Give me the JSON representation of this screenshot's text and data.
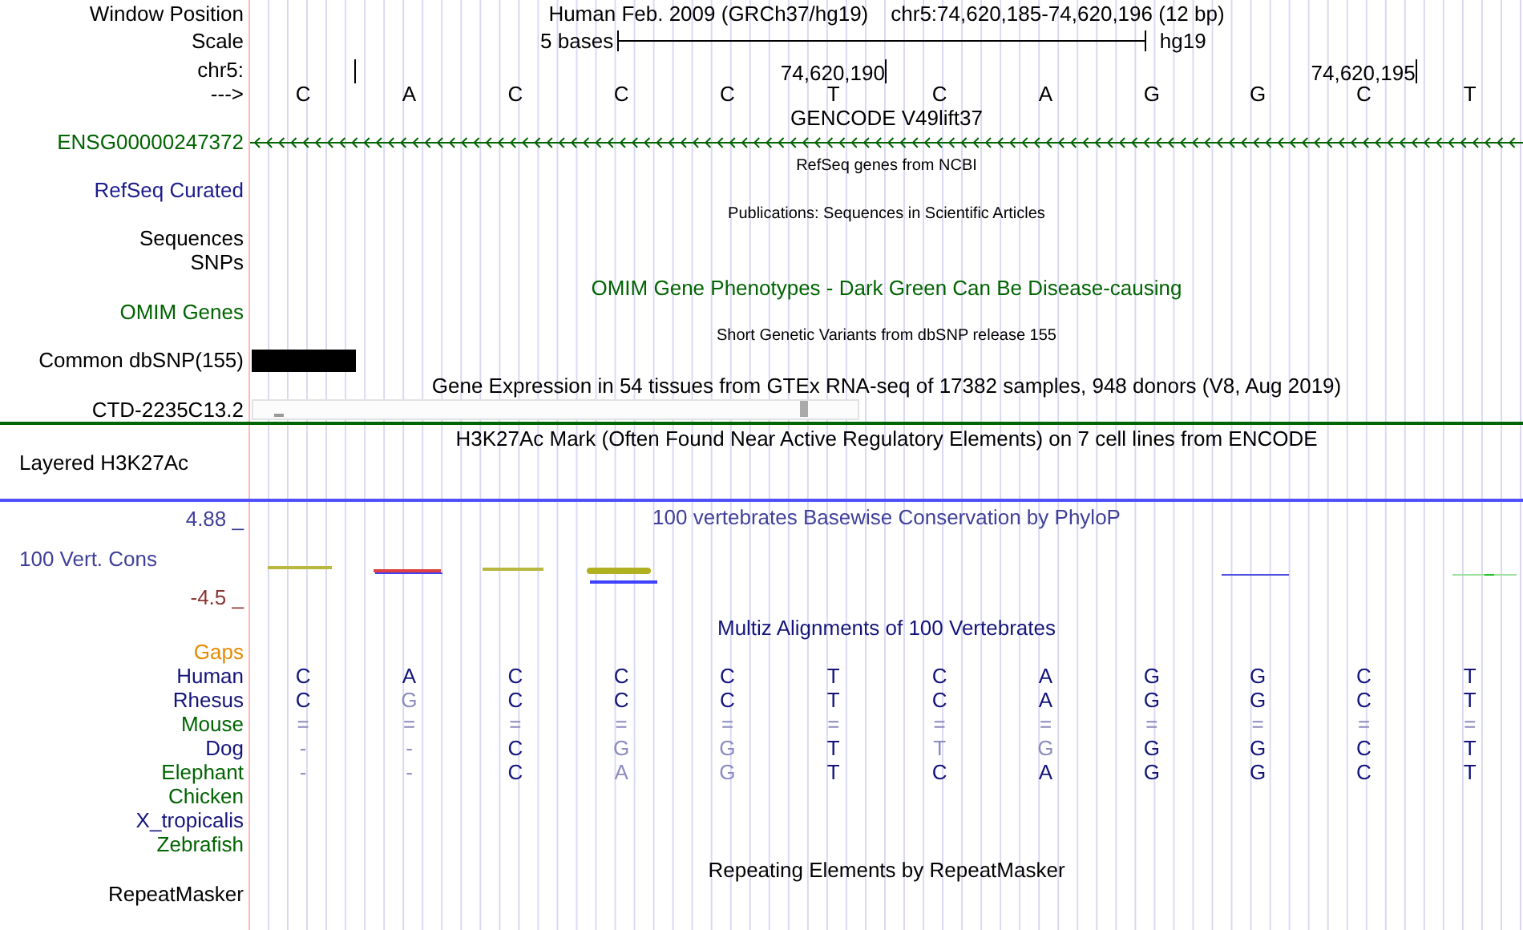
{
  "header": {
    "window_position_label": "Window Position",
    "assembly": "Human Feb. 2009 (GRCh37/hg19)",
    "position": "chr5:74,620,185-74,620,196 (12 bp)",
    "scale_label": "Scale",
    "scale_span": "5 bases",
    "scale_assembly": "hg19",
    "chrom_label": "chr5:",
    "strand_label": "--->",
    "tick_labels": [
      "74,620,190",
      "74,620,195"
    ],
    "bases": [
      "C",
      "A",
      "C",
      "C",
      "C",
      "T",
      "C",
      "A",
      "G",
      "G",
      "C",
      "T"
    ]
  },
  "tracks": [
    {
      "kind": "title",
      "title": "GENCODE V49lift37",
      "color": "#000000"
    },
    {
      "kind": "gene",
      "label": "ENSG00000247372",
      "color": "#006400"
    },
    {
      "kind": "note",
      "title": "RefSeq genes from NCBI"
    },
    {
      "kind": "label",
      "label": "RefSeq Curated",
      "color": "#1c1c8c"
    },
    {
      "kind": "note",
      "title": "Publications: Sequences in Scientific Articles"
    },
    {
      "kind": "label",
      "label": "Sequences",
      "color": "#000000"
    },
    {
      "kind": "label",
      "label": "SNPs",
      "color": "#000000"
    },
    {
      "kind": "title",
      "title": "OMIM Gene Phenotypes - Dark Green Can Be Disease-causing",
      "color": "#006400"
    },
    {
      "kind": "label",
      "label": "OMIM Genes",
      "color": "#006400"
    },
    {
      "kind": "note",
      "title": "Short Genetic Variants from dbSNP release 155"
    },
    {
      "kind": "snp",
      "label": "Common dbSNP(155)",
      "color": "#000000"
    },
    {
      "kind": "title",
      "title": "Gene Expression in 54 tissues from GTEx RNA-seq of 17382 samples, 948 donors (V8, Aug 2019)",
      "color": "#000000"
    },
    {
      "kind": "expression",
      "label": "CTD-2235C13.2",
      "color": "#000000"
    },
    {
      "kind": "title",
      "title": "H3K27Ac Mark (Often Found Near Active Regulatory Elements) on 7 cell lines from ENCODE",
      "color": "#000000"
    },
    {
      "kind": "layered",
      "label": "Layered H3K27Ac",
      "color": "#000000"
    },
    {
      "kind": "conservation",
      "title": "100 vertebrates Basewise Conservation by PhyloP",
      "label": "100 Vert. Cons",
      "max": "4.88 _",
      "min": "-4.5 _",
      "color": "#40409a"
    },
    {
      "kind": "title",
      "title": "Multiz Alignments of 100 Vertebrates",
      "color": "#14147a"
    },
    {
      "kind": "species",
      "label": "Gaps",
      "color": "#e68a00"
    },
    {
      "kind": "species",
      "label": "Human",
      "color": "#14147a",
      "bases": [
        {
          "text": "C",
          "dim": false
        },
        {
          "text": "A",
          "dim": false
        },
        {
          "text": "C",
          "dim": false
        },
        {
          "text": "C",
          "dim": false
        },
        {
          "text": "C",
          "dim": false
        },
        {
          "text": "T",
          "dim": false
        },
        {
          "text": "C",
          "dim": false
        },
        {
          "text": "A",
          "dim": false
        },
        {
          "text": "G",
          "dim": false
        },
        {
          "text": "G",
          "dim": false
        },
        {
          "text": "C",
          "dim": false
        },
        {
          "text": "T",
          "dim": false
        }
      ]
    },
    {
      "kind": "species",
      "label": "Rhesus",
      "color": "#14147a",
      "bases": [
        {
          "text": "C",
          "dim": false
        },
        {
          "text": "G",
          "dim": true
        },
        {
          "text": "C",
          "dim": false
        },
        {
          "text": "C",
          "dim": false
        },
        {
          "text": "C",
          "dim": false
        },
        {
          "text": "T",
          "dim": false
        },
        {
          "text": "C",
          "dim": false
        },
        {
          "text": "A",
          "dim": false
        },
        {
          "text": "G",
          "dim": false
        },
        {
          "text": "G",
          "dim": false
        },
        {
          "text": "C",
          "dim": false
        },
        {
          "text": "T",
          "dim": false
        }
      ]
    },
    {
      "kind": "species",
      "label": "Mouse",
      "color": "#006400",
      "bases": [
        {
          "text": "=",
          "dim": true
        },
        {
          "text": "=",
          "dim": true
        },
        {
          "text": "=",
          "dim": true
        },
        {
          "text": "=",
          "dim": true
        },
        {
          "text": "=",
          "dim": true
        },
        {
          "text": "=",
          "dim": true
        },
        {
          "text": "=",
          "dim": true
        },
        {
          "text": "=",
          "dim": true
        },
        {
          "text": "=",
          "dim": true
        },
        {
          "text": "=",
          "dim": true
        },
        {
          "text": "=",
          "dim": true
        },
        {
          "text": "=",
          "dim": true
        }
      ]
    },
    {
      "kind": "species",
      "label": "Dog",
      "color": "#14147a",
      "bases": [
        {
          "text": "-",
          "dim": true
        },
        {
          "text": "-",
          "dim": true
        },
        {
          "text": "C",
          "dim": false
        },
        {
          "text": "G",
          "dim": true
        },
        {
          "text": "G",
          "dim": true
        },
        {
          "text": "T",
          "dim": false
        },
        {
          "text": "T",
          "dim": true
        },
        {
          "text": "G",
          "dim": true
        },
        {
          "text": "G",
          "dim": false
        },
        {
          "text": "G",
          "dim": false
        },
        {
          "text": "C",
          "dim": false
        },
        {
          "text": "T",
          "dim": false
        }
      ]
    },
    {
      "kind": "species",
      "label": "Elephant",
      "color": "#006400",
      "bases": [
        {
          "text": "-",
          "dim": true
        },
        {
          "text": "-",
          "dim": true
        },
        {
          "text": "C",
          "dim": false
        },
        {
          "text": "A",
          "dim": true
        },
        {
          "text": "G",
          "dim": true
        },
        {
          "text": "T",
          "dim": false
        },
        {
          "text": "C",
          "dim": false
        },
        {
          "text": "A",
          "dim": false
        },
        {
          "text": "G",
          "dim": false
        },
        {
          "text": "G",
          "dim": false
        },
        {
          "text": "C",
          "dim": false
        },
        {
          "text": "T",
          "dim": false
        }
      ]
    },
    {
      "kind": "species",
      "label": "Chicken",
      "color": "#006400"
    },
    {
      "kind": "species",
      "label": "X_tropicalis",
      "color": "#14147a"
    },
    {
      "kind": "species",
      "label": "Zebrafish",
      "color": "#006400"
    },
    {
      "kind": "title",
      "title": "Repeating Elements by RepeatMasker",
      "color": "#000000"
    },
    {
      "kind": "label",
      "label": "RepeatMasker",
      "color": "#000000"
    }
  ]
}
